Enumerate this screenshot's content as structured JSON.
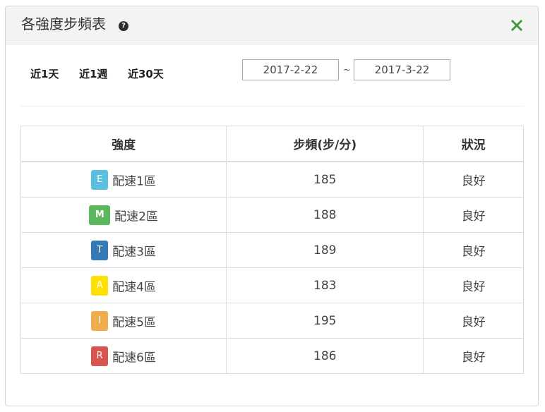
{
  "header": {
    "title": "各強度步頻表",
    "help_icon": "?",
    "close_icon": "close-icon"
  },
  "range_links": [
    "近1天",
    "近1週",
    "近30天"
  ],
  "date_range": {
    "start": "2017-2-22",
    "separator": "~",
    "end": "2017-3-22"
  },
  "table": {
    "headers": [
      "強度",
      "步頻(步/分)",
      "狀況"
    ],
    "rows": [
      {
        "badge": "E",
        "color": "#5bc0de",
        "zone": "配速1區",
        "cadence": "185",
        "status": "良好"
      },
      {
        "badge": "M",
        "color": "#5cb85c",
        "zone": "配速2區",
        "cadence": "188",
        "status": "良好"
      },
      {
        "badge": "T",
        "color": "#337ab7",
        "zone": "配速3區",
        "cadence": "189",
        "status": "良好"
      },
      {
        "badge": "A",
        "color": "#ffe000",
        "zone": "配速4區",
        "cadence": "183",
        "status": "良好"
      },
      {
        "badge": "I",
        "color": "#f0ad4e",
        "zone": "配速5區",
        "cadence": "195",
        "status": "良好"
      },
      {
        "badge": "R",
        "color": "#d9534f",
        "zone": "配速6區",
        "cadence": "186",
        "status": "良好"
      }
    ]
  },
  "colors": {
    "close_icon": "#3c9a3c"
  }
}
